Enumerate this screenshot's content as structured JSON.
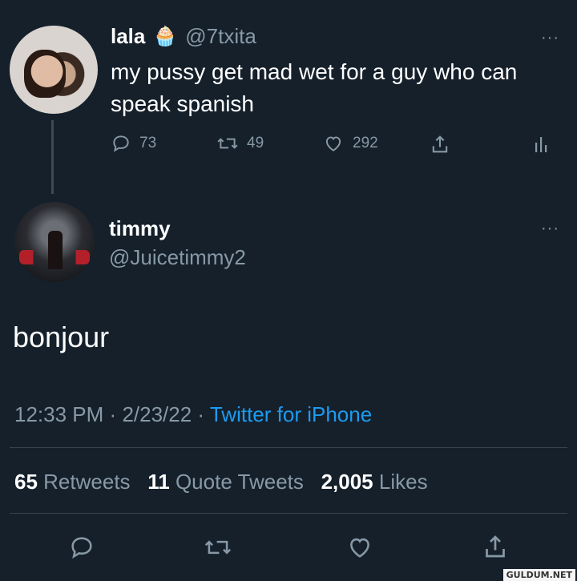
{
  "tweet1": {
    "name": "lala",
    "emoji": "🧁",
    "handle": "@7txita",
    "text": "my pussy get mad wet for a guy who can speak spanish",
    "replies": "73",
    "retweets": "49",
    "likes": "292",
    "more": "···"
  },
  "tweet2": {
    "name": "timmy",
    "handle": "@Juicetimmy2",
    "text": "bonjour",
    "time": "12:33 PM",
    "date": "2/23/22",
    "source": "Twitter for iPhone",
    "retweets_count": "65",
    "retweets_label": "Retweets",
    "quotes_count": "11",
    "quotes_label": "Quote Tweets",
    "likes_count": "2,005",
    "likes_label": "Likes",
    "more": "···"
  },
  "watermark": "GULDUM.NET"
}
